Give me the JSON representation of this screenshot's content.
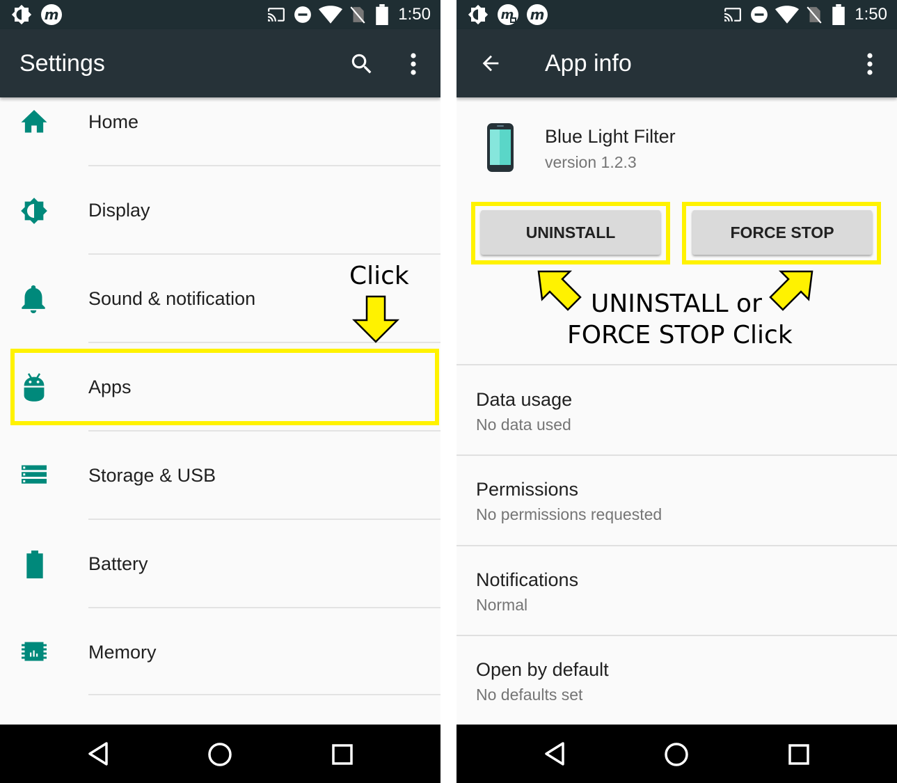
{
  "left_screen": {
    "status_time": "1:50",
    "title": "Settings",
    "items": [
      {
        "label": "Home"
      },
      {
        "label": "Display"
      },
      {
        "label": "Sound & notification"
      },
      {
        "label": "Apps"
      },
      {
        "label": "Storage & USB"
      },
      {
        "label": "Battery"
      },
      {
        "label": "Memory"
      }
    ],
    "annotation": "Click"
  },
  "right_screen": {
    "status_time": "1:50",
    "title": "App info",
    "app_name": "Blue Light Filter",
    "app_version": "version 1.2.3",
    "uninstall_label": "UNINSTALL",
    "force_stop_label": "FORCE STOP",
    "annotation_line1": "UNINSTALL or",
    "annotation_line2": "FORCE STOP Click",
    "sections": [
      {
        "title": "Data usage",
        "subtitle": "No data used"
      },
      {
        "title": "Permissions",
        "subtitle": "No permissions requested"
      },
      {
        "title": "Notifications",
        "subtitle": "Normal"
      },
      {
        "title": "Open by default",
        "subtitle": "No defaults set"
      }
    ]
  },
  "colors": {
    "toolbar": "#263238",
    "statusbar": "#1f2e33",
    "accent_teal": "#00897b",
    "highlight": "#fff200"
  },
  "icons": {
    "status_left": [
      "brightness-icon",
      "m-app-icon",
      "m-app-icon"
    ],
    "status_right": [
      "cast-icon",
      "do-not-disturb-icon",
      "wifi-icon",
      "no-sim-icon",
      "battery-icon"
    ],
    "settings_items": [
      "home-icon",
      "display-icon",
      "bell-icon",
      "android-icon",
      "storage-icon",
      "battery-icon",
      "memory-icon"
    ]
  }
}
